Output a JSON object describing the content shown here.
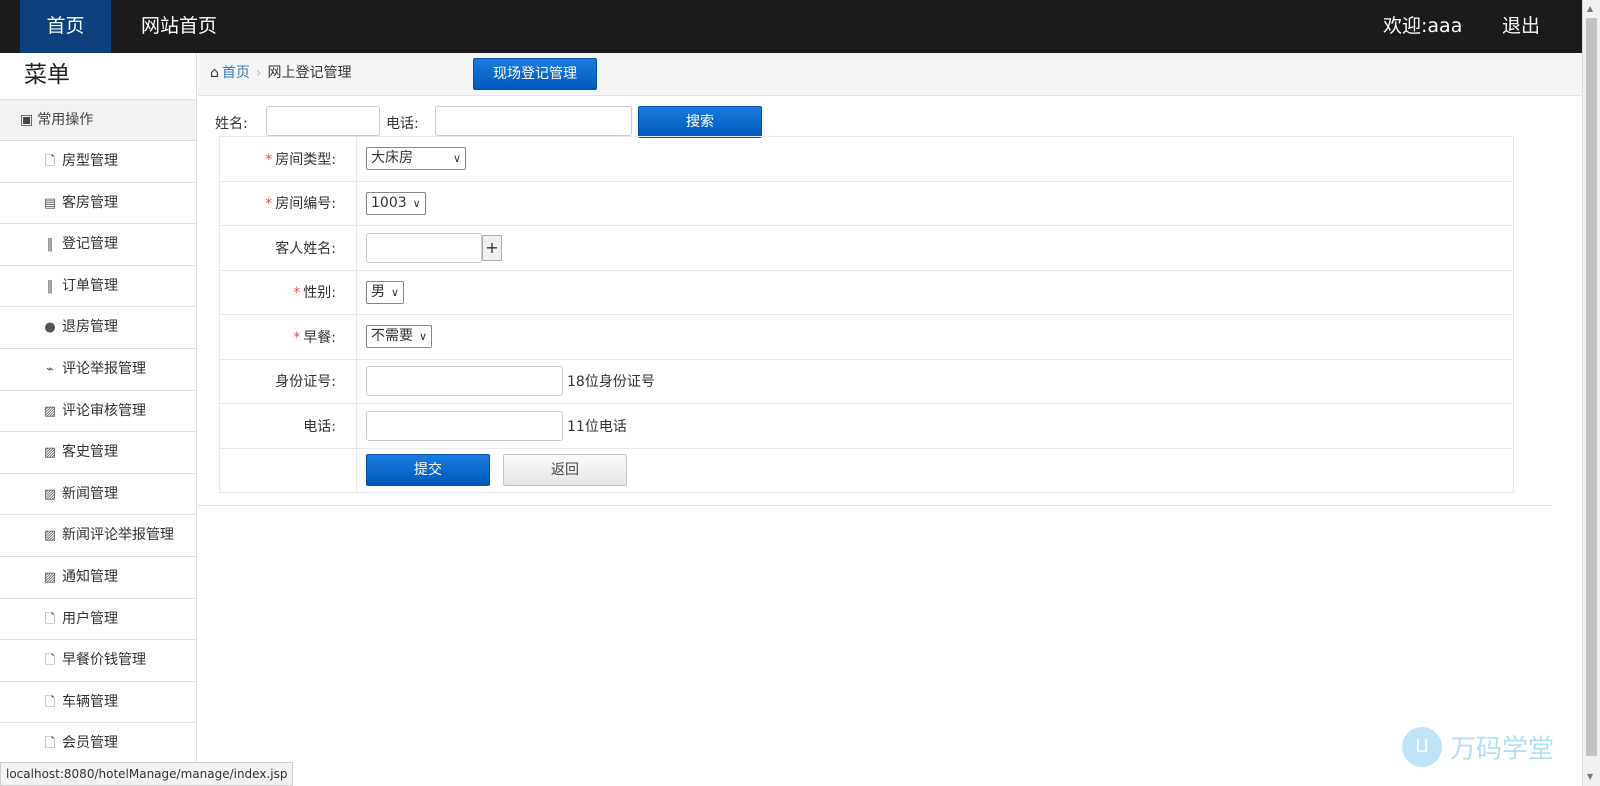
{
  "topnav": {
    "home": "首页",
    "site_home": "网站首页",
    "welcome": "欢迎:aaa",
    "logout": "退出"
  },
  "sidebar": {
    "title": "菜单",
    "group": "常用操作",
    "items": [
      {
        "label": "房型管理",
        "icon": "file-icon"
      },
      {
        "label": "客房管理",
        "icon": "list-icon"
      },
      {
        "label": "登记管理",
        "icon": "books-icon"
      },
      {
        "label": "订单管理",
        "icon": "books-icon"
      },
      {
        "label": "退房管理",
        "icon": "comment-icon"
      },
      {
        "label": "评论举报管理",
        "icon": "plug-icon"
      },
      {
        "label": "评论审核管理",
        "icon": "picture-icon"
      },
      {
        "label": "客史管理",
        "icon": "picture-icon"
      },
      {
        "label": "新闻管理",
        "icon": "picture-icon"
      },
      {
        "label": "新闻评论举报管理",
        "icon": "picture-icon"
      },
      {
        "label": "通知管理",
        "icon": "picture-icon"
      },
      {
        "label": "用户管理",
        "icon": "file-icon"
      },
      {
        "label": "早餐价钱管理",
        "icon": "file-icon"
      },
      {
        "label": "车辆管理",
        "icon": "file-icon"
      },
      {
        "label": "会员管理",
        "icon": "file-icon"
      }
    ]
  },
  "breadcrumb": {
    "home": "首页",
    "current": "网上登记管理"
  },
  "onsite_button": "现场登记管理",
  "search": {
    "name_label": "姓名:",
    "name_value": "",
    "phone_label": "电话:",
    "phone_value": "",
    "button": "搜索"
  },
  "form": {
    "room_type_label": "房间类型:",
    "room_type_value": "大床房",
    "room_no_label": "房间编号:",
    "room_no_value": "1003",
    "guest_name_label": "客人姓名:",
    "guest_name_value": "",
    "add_guest": "+",
    "gender_label": "性别:",
    "gender_value": "男",
    "breakfast_label": "早餐:",
    "breakfast_value": "不需要",
    "id_label": "身份证号:",
    "id_value": "",
    "id_hint": "18位身份证号",
    "phone_label": "电话:",
    "phone_value": "",
    "phone_hint": "11位电话",
    "submit": "提交",
    "back": "返回",
    "required_mark": "*"
  },
  "statusbar": "localhost:8080/hotelManage/manage/index.jsp",
  "watermark": "万码学堂",
  "colors": {
    "topbar": "#1b1b1b",
    "nav_active": "#0b3f7d",
    "primary": "#0a6ad6",
    "link": "#3a7bc0",
    "required": "#d9534f"
  }
}
